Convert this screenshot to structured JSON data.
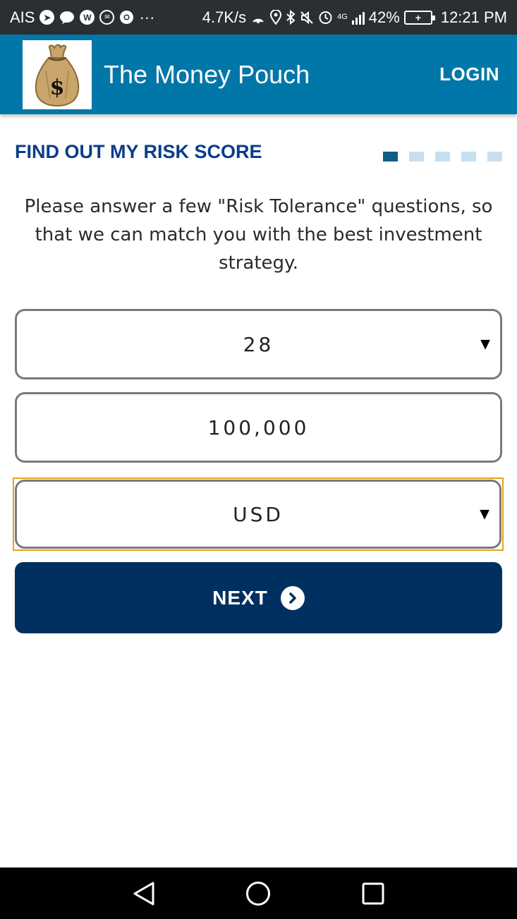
{
  "status_bar": {
    "carrier": "AIS",
    "more": "···",
    "net_speed": "4.7K/s",
    "network_type": "4G",
    "battery_percent": "42%",
    "time": "12:21 PM",
    "icons": [
      "telegram-icon",
      "messenger-icon",
      "whatsapp-icon",
      "mail-icon",
      "chrome-icon",
      "hotspot-icon",
      "location-icon",
      "bluetooth-icon",
      "mute-icon",
      "alarm-icon",
      "signal-icon",
      "battery-icon"
    ]
  },
  "header": {
    "title": "The Money Pouch",
    "login_label": "LOGIN",
    "logo_icon": "money-bag-icon",
    "background_color": "#0077a8"
  },
  "page": {
    "section_title": "FIND OUT MY RISK SCORE",
    "progress": {
      "total_steps": 5,
      "current_step": 1
    },
    "intro": "Please answer a few \"Risk Tolerance\" questions, so that we can match you with the best investment strategy."
  },
  "form": {
    "age_value": "28",
    "amount_value": "100,000",
    "currency_value": "USD",
    "next_label": "NEXT"
  },
  "nav_bar": {
    "icons": [
      "back-icon",
      "home-icon",
      "recents-icon"
    ]
  },
  "colors": {
    "title_blue": "#0a3d8a",
    "button_navy": "#00305f",
    "focus_orange": "#e8a317",
    "progress_active": "#0c5f86",
    "progress_inactive": "#c6e0f2"
  }
}
